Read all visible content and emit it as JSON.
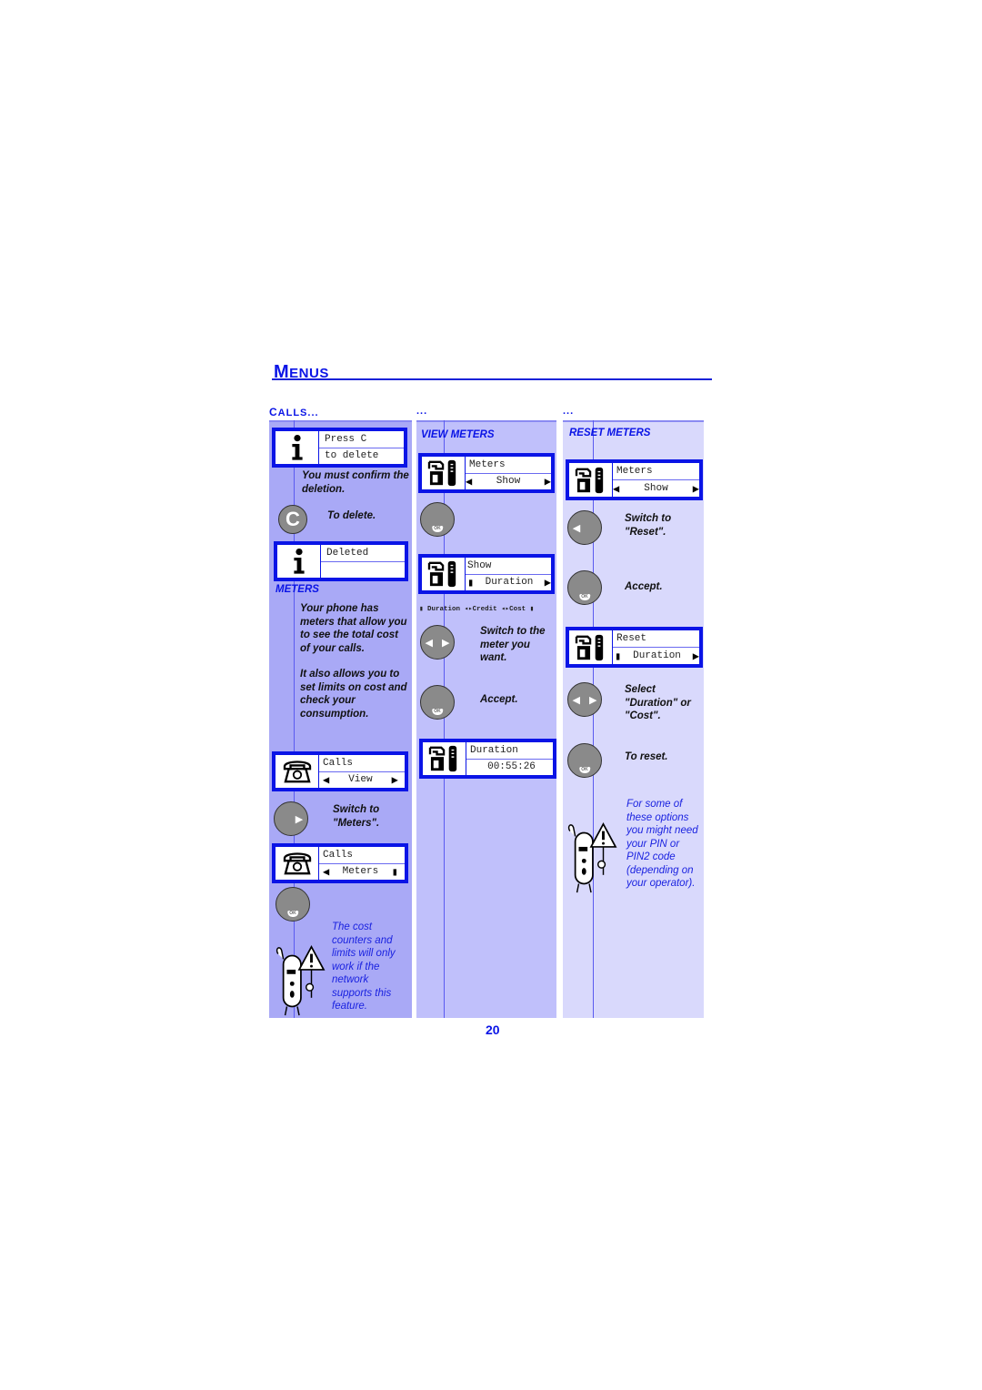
{
  "page": {
    "title_initial": "M",
    "title_rest": "ENUS",
    "page_number": "20",
    "colors": {
      "accent": "#0a14e6",
      "panel1": "#a9a9f6",
      "panel2": "#c0c0fb",
      "panel3": "#d9d9fc"
    }
  },
  "columns": [
    {
      "heading_initial": "C",
      "heading_rest": "ALLS..."
    },
    {
      "heading": "..."
    },
    {
      "heading": "..."
    }
  ],
  "col1": {
    "lcd1": {
      "icon": "info-icon",
      "line1": "Press C",
      "line2": "to delete"
    },
    "confirm_text": "You must confirm the deletion.",
    "c_button": {
      "icon": "c-key-icon",
      "label": "C",
      "text": "To delete."
    },
    "lcd2": {
      "icon": "info-icon",
      "line1": "Deleted",
      "line2": ""
    },
    "meters_heading": "METERS",
    "meters_para1": "Your phone has meters that allow you to see the total cost of your calls.",
    "meters_para2": "It also allows you to set limits on  cost and check your consumption.",
    "lcd3": {
      "icon": "telephone-icon",
      "line1": "Calls",
      "line2": "View"
    },
    "right_button_text": "Switch to \"Meters\".",
    "lcd4": {
      "icon": "telephone-icon",
      "line1": "Calls",
      "line2": "Meters"
    },
    "ok_button": {
      "label": "OK"
    },
    "warning_note": "The cost counters and limits will only work if the network supports this feature."
  },
  "col2": {
    "heading": "VIEW METERS",
    "lcd1": {
      "icon": "meter-phone-icon",
      "line1": "Meters",
      "line2": "Show"
    },
    "ok1": {
      "label": "OK"
    },
    "lcd2": {
      "icon": "meter-phone-icon",
      "line1": "Show",
      "line2": "Duration"
    },
    "legend": {
      "item1": "Duration",
      "item2": "Credit",
      "item3": "Cost"
    },
    "nav_text": "Switch to the meter you want.",
    "ok2": {
      "label": "OK",
      "text": "Accept."
    },
    "lcd3": {
      "icon": "meter-phone-icon",
      "line1": "Duration",
      "line2": "00:55:26"
    }
  },
  "col3": {
    "heading": "RESET METERS",
    "lcd1": {
      "icon": "meter-phone-icon",
      "line1": "Meters",
      "line2": "Show"
    },
    "left_text": "Switch to \"Reset\".",
    "ok1": {
      "label": "OK",
      "text": "Accept."
    },
    "lcd2": {
      "icon": "meter-phone-icon",
      "line1": "Reset",
      "line2": "Duration"
    },
    "nav_text": "Select \"Duration\" or \"Cost\".",
    "ok2": {
      "label": "OK",
      "text": "To reset."
    },
    "warning_note": "For some of these options you might need your PIN or PIN2 code (depending on your operator)."
  }
}
